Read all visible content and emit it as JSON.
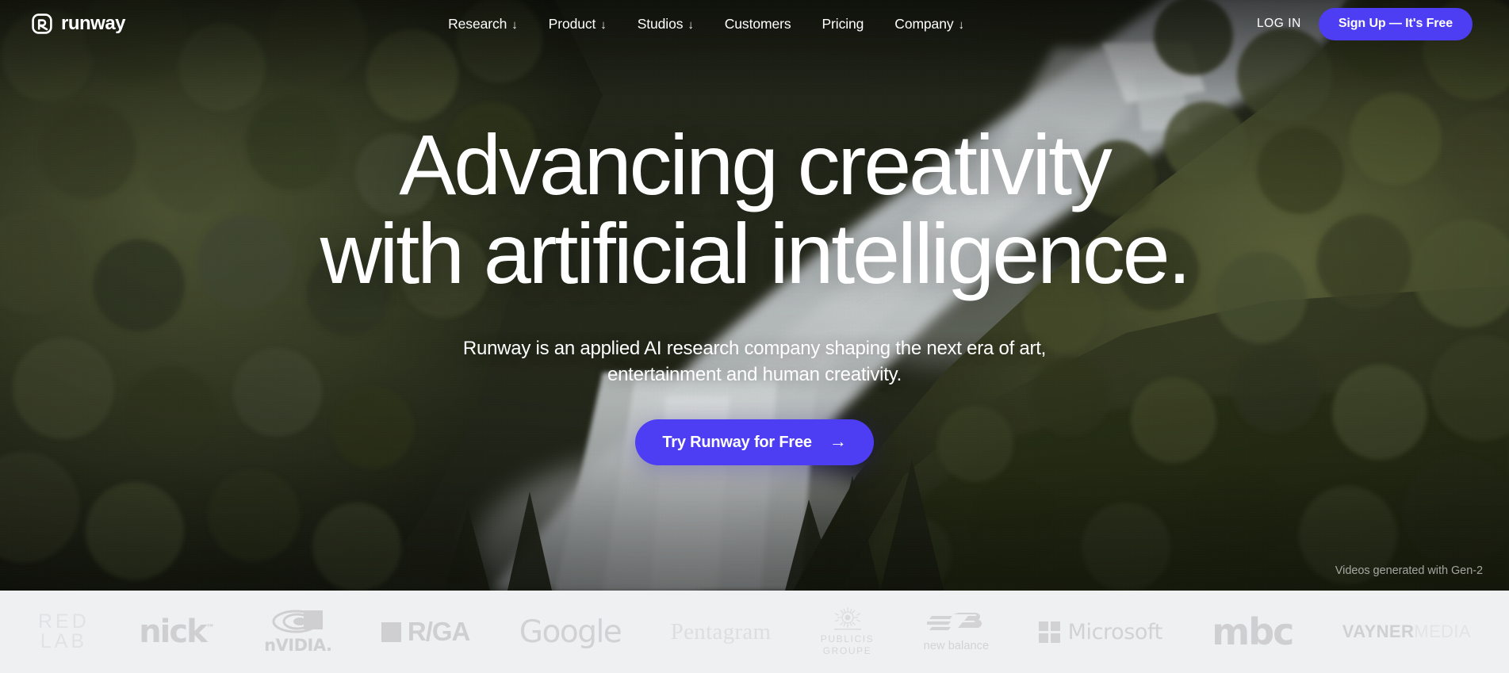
{
  "brand": {
    "name": "runway",
    "logo_icon": "runway-logo-mark"
  },
  "nav": {
    "links": [
      {
        "label": "Research",
        "caret": "↓",
        "has_dropdown": true
      },
      {
        "label": "Product",
        "caret": "↓",
        "has_dropdown": true
      },
      {
        "label": "Studios",
        "caret": "↓",
        "has_dropdown": true
      },
      {
        "label": "Customers",
        "caret": "",
        "has_dropdown": false
      },
      {
        "label": "Pricing",
        "caret": "",
        "has_dropdown": false
      },
      {
        "label": "Company",
        "caret": "↓",
        "has_dropdown": true
      }
    ],
    "login_label": "LOG IN",
    "signup_label": "Sign Up — It's Free"
  },
  "hero": {
    "headline_line1": "Advancing creativity",
    "headline_line2": "with artificial intelligence.",
    "subhead_line1": "Runway is an applied AI research company shaping the",
    "subhead_line2": "next era of art, entertainment and human creativity.",
    "cta_label": "Try Runway for Free",
    "cta_arrow": "→",
    "credit": "Videos generated with Gen-2"
  },
  "logos": {
    "items": [
      {
        "name": "redlab",
        "line1": "RED",
        "line2": "LAB"
      },
      {
        "name": "nickelodeon",
        "label": "nick",
        "tm": "™"
      },
      {
        "name": "nvidia",
        "label": "nVIDIA."
      },
      {
        "name": "rga",
        "label": "R/GA"
      },
      {
        "name": "google",
        "label": "Google"
      },
      {
        "name": "pentagram",
        "label": "Pentagram"
      },
      {
        "name": "publicis-groupe",
        "line1": "PUBLICIS",
        "line2": "GROUPE"
      },
      {
        "name": "new-balance",
        "label": "new balance"
      },
      {
        "name": "microsoft",
        "label": "Microsoft"
      },
      {
        "name": "mbc",
        "label": "mbc"
      },
      {
        "name": "vaynermedia",
        "bold": "VAYNER",
        "light": "MEDIA"
      }
    ]
  },
  "colors": {
    "accent": "#4d3df3",
    "hero_text": "#ffffff",
    "logo_strip_bg": "#eff0f2",
    "logo_gray": "#d0d0d3",
    "forest_dark": "#262a1c",
    "forest_mid": "#3e442c",
    "water_gray": "#b9bdbd"
  }
}
